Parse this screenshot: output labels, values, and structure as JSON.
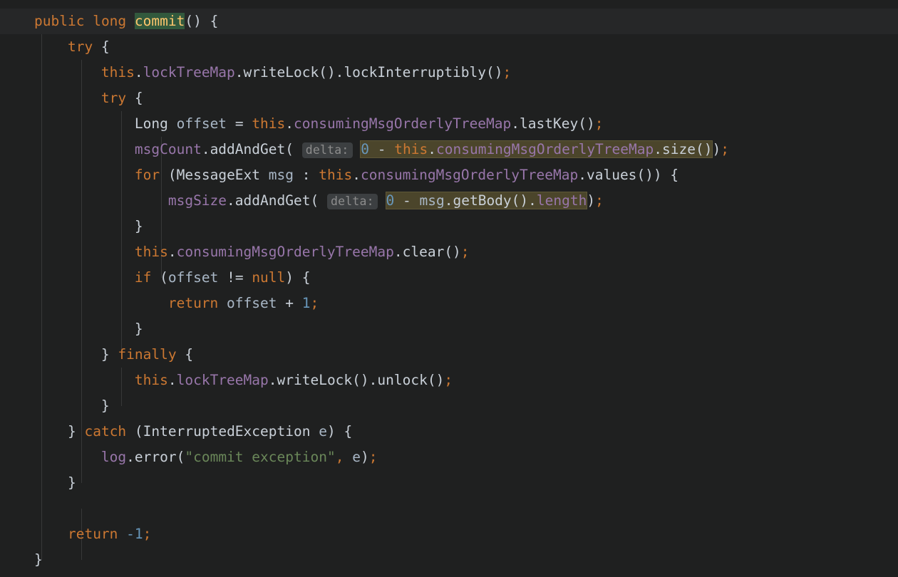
{
  "editor": {
    "language": "java",
    "theme": "darcula",
    "background_color": "#1f2020",
    "current_line_color": "#262728",
    "selection_color": "#4b452b",
    "indent_guide_color": "#373838",
    "colors": {
      "keyword": "#cc7832",
      "method_declaration": "#ffc66d",
      "field": "#9876aa",
      "method_call": "#c9d0d8",
      "identifier": "#a9b7c6",
      "number": "#6897bb",
      "string": "#6a8759",
      "punctuation": "#c9d0d8",
      "inlay_hint_text": "#8c8c8c",
      "inlay_hint_background": "#3c3f41"
    }
  },
  "code": {
    "lines": [
      {
        "n": 1,
        "current": true,
        "indent": 0,
        "text": "public long commit() {"
      },
      {
        "n": 2,
        "current": false,
        "indent": 1,
        "text": "try {"
      },
      {
        "n": 3,
        "current": false,
        "indent": 2,
        "text": "this.lockTreeMap.writeLock().lockInterruptibly();"
      },
      {
        "n": 4,
        "current": false,
        "indent": 2,
        "text": "try {"
      },
      {
        "n": 5,
        "current": false,
        "indent": 3,
        "text": "Long offset = this.consumingMsgOrderlyTreeMap.lastKey();"
      },
      {
        "n": 6,
        "current": false,
        "indent": 3,
        "text": "msgCount.addAndGet( delta: 0 - this.consumingMsgOrderlyTreeMap.size());"
      },
      {
        "n": 7,
        "current": false,
        "indent": 3,
        "text": "for (MessageExt msg : this.consumingMsgOrderlyTreeMap.values()) {"
      },
      {
        "n": 8,
        "current": false,
        "indent": 4,
        "text": "msgSize.addAndGet( delta: 0 - msg.getBody().length);"
      },
      {
        "n": 9,
        "current": false,
        "indent": 3,
        "text": "}"
      },
      {
        "n": 10,
        "current": false,
        "indent": 3,
        "text": "this.consumingMsgOrderlyTreeMap.clear();"
      },
      {
        "n": 11,
        "current": false,
        "indent": 3,
        "text": "if (offset != null) {"
      },
      {
        "n": 12,
        "current": false,
        "indent": 4,
        "text": "return offset + 1;"
      },
      {
        "n": 13,
        "current": false,
        "indent": 3,
        "text": "}"
      },
      {
        "n": 14,
        "current": false,
        "indent": 2,
        "text": "} finally {"
      },
      {
        "n": 15,
        "current": false,
        "indent": 3,
        "text": "this.lockTreeMap.writeLock().unlock();"
      },
      {
        "n": 16,
        "current": false,
        "indent": 2,
        "text": "}"
      },
      {
        "n": 17,
        "current": false,
        "indent": 1,
        "text": "} catch (InterruptedException e) {"
      },
      {
        "n": 18,
        "current": false,
        "indent": 2,
        "text": "log.error(\"commit exception\", e);"
      },
      {
        "n": 19,
        "current": false,
        "indent": 1,
        "text": "}"
      },
      {
        "n": 20,
        "current": false,
        "indent": 0,
        "text": ""
      },
      {
        "n": 21,
        "current": false,
        "indent": 1,
        "text": "return -1;"
      },
      {
        "n": 22,
        "current": false,
        "indent": 0,
        "text": "}"
      }
    ],
    "tokens": {
      "kw_public": "public",
      "kw_long": "long",
      "name_commit": "commit",
      "kw_try": "try",
      "kw_for": "for",
      "kw_if": "if",
      "kw_null": "null",
      "kw_return": "return",
      "kw_catch": "catch",
      "kw_finally": "finally",
      "kw_this": "this",
      "field_lockTreeMap": "lockTreeMap",
      "field_consumingMsgOrderlyTreeMap": "consumingMsgOrderlyTreeMap",
      "field_msgCount": "msgCount",
      "field_msgSize": "msgSize",
      "field_log": "log",
      "field_length": "length",
      "m_writeLock": "writeLock",
      "m_lockInterruptibly": "lockInterruptibly",
      "m_unlock": "unlock",
      "m_lastKey": "lastKey",
      "m_addAndGet": "addAndGet",
      "m_size": "size",
      "m_values": "values",
      "m_clear": "clear",
      "m_getBody": "getBody",
      "m_error": "error",
      "type_Long": "Long",
      "type_MessageExt": "MessageExt",
      "type_InterruptedException": "InterruptedException",
      "var_offset": "offset",
      "var_msg": "msg",
      "var_e": "e",
      "num_zero": "0",
      "num_one": "1",
      "num_minus_one": "-1",
      "string_commit_exception": "\"commit exception\"",
      "hint_delta": "delta:"
    }
  }
}
